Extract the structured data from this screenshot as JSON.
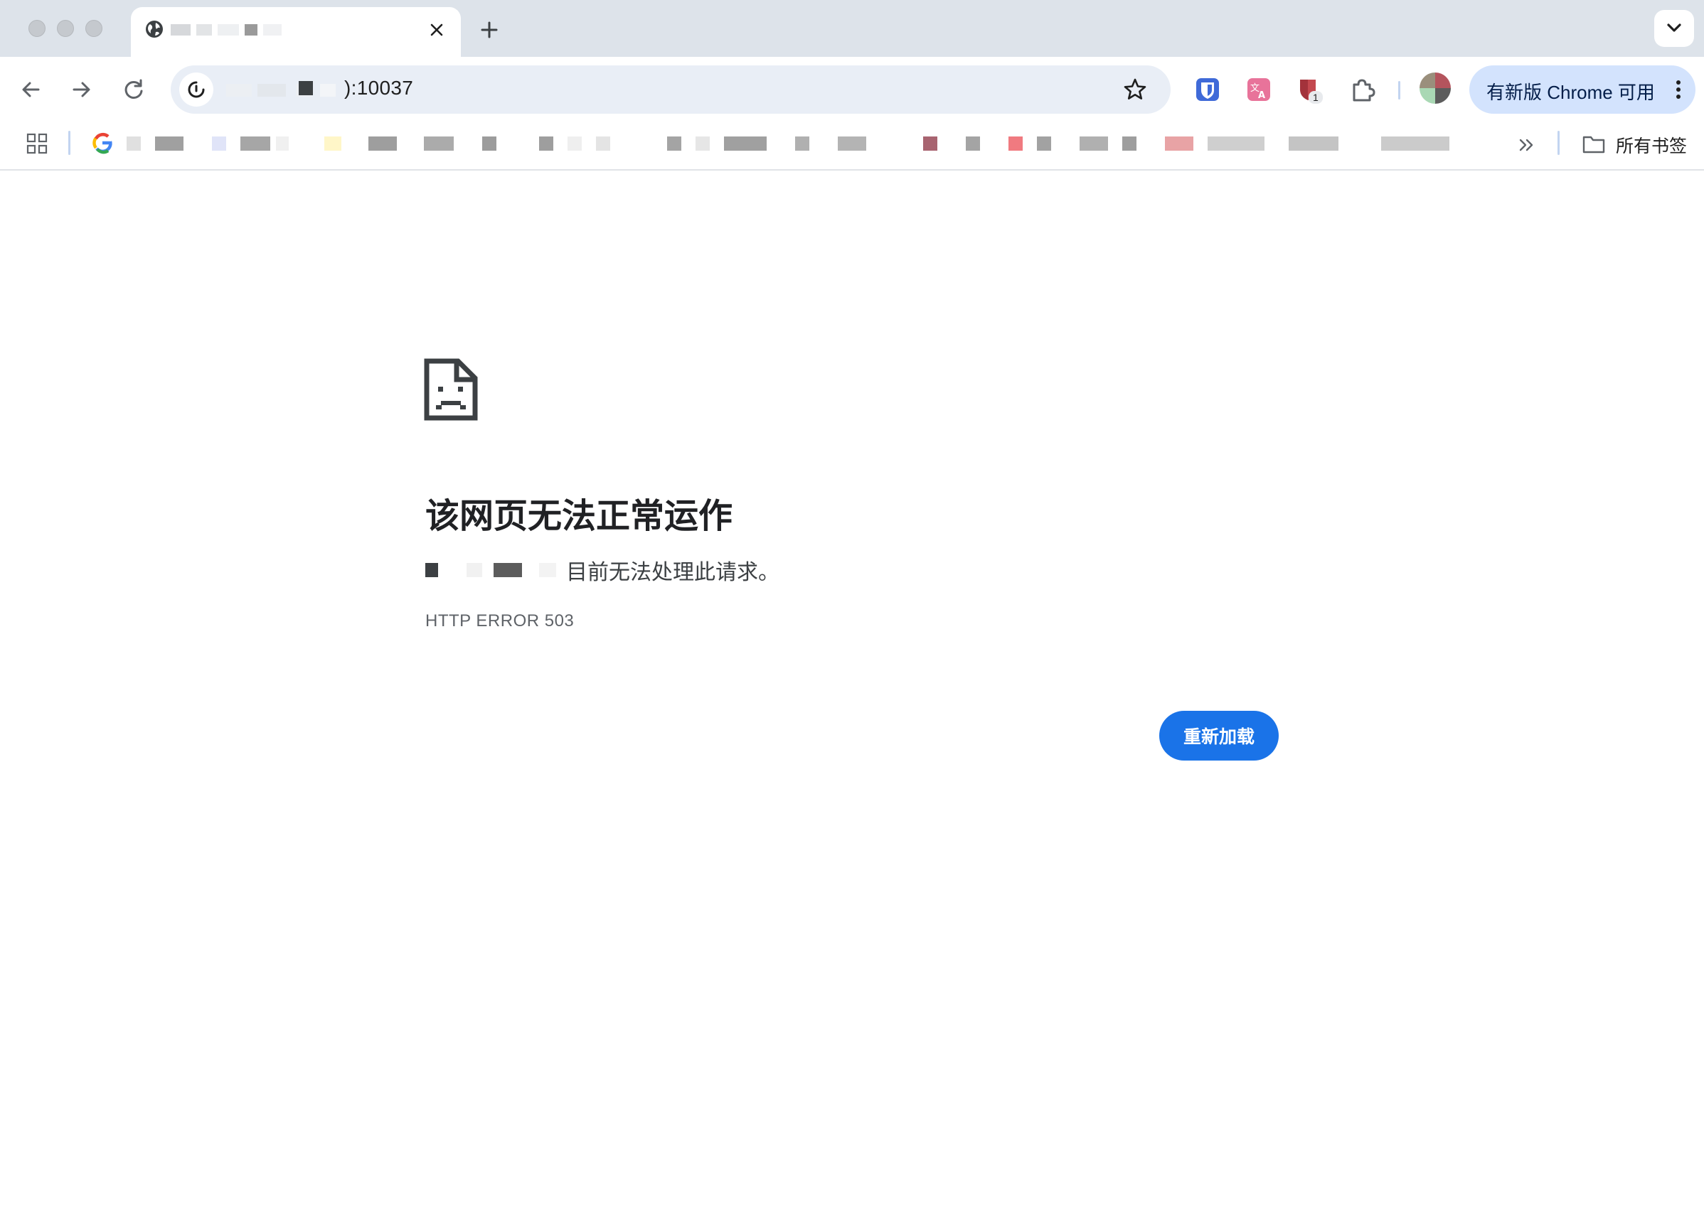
{
  "window": {
    "controls": [
      "close",
      "minimize",
      "zoom"
    ]
  },
  "tab": {
    "title": "",
    "favicon": "globe-icon",
    "close_icon": "close-icon",
    "new_tab_icon": "plus-icon",
    "tab_search_icon": "chevron-down-icon"
  },
  "toolbar": {
    "back_icon": "arrow-left-icon",
    "forward_icon": "arrow-right-icon",
    "reload_icon": "reload-icon",
    "url": "):10037",
    "site_info_icon": "not-secure-icon",
    "bookmark_star_icon": "star-icon",
    "extensions": [
      "bitwarden-icon",
      "translate-icon",
      "shield-icon",
      "puzzle-icon"
    ],
    "extension_badge": "1",
    "update_chip": {
      "label": "有新版 Chrome 可用",
      "menu_icon": "more-vert-icon"
    }
  },
  "bookmarks_bar": {
    "apps_icon": "apps-grid-icon",
    "google_icon": "google-icon",
    "overflow_icon": "double-chevron-right-icon",
    "all_bookmarks": {
      "icon": "folder-icon",
      "label": "所有书签"
    }
  },
  "error_page": {
    "icon": "sad-page-icon",
    "title": "该网页无法正常运作",
    "message": "目前无法处理此请求。",
    "code": "HTTP ERROR 503",
    "reload_button": "重新加载"
  },
  "colors": {
    "tabstrip": "#dde3ea",
    "omnibox": "#e9eef6",
    "update_chip": "#d3e3fd",
    "reload_button": "#1a73e8",
    "title_text": "#202124"
  }
}
